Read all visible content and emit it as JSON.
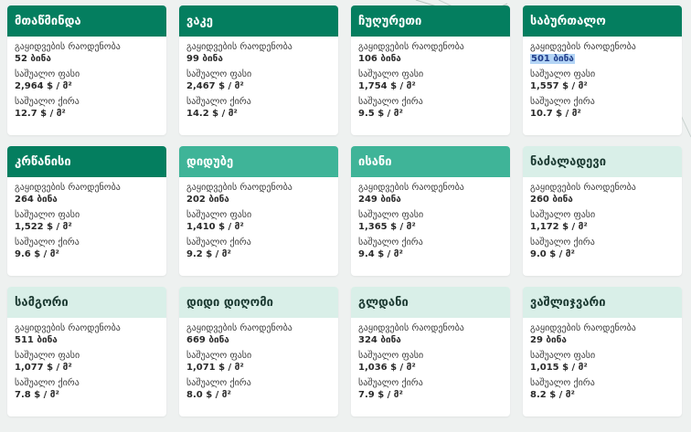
{
  "cards": [
    {
      "name": "მთაწმინდა",
      "listings_label": "გაყიდვების რაოდენობა",
      "listings": "52 ბინა",
      "price_label": "საშუალო ფასი",
      "price": "2,964 $ / მ²",
      "rent_label": "საშუალო ქირა",
      "rent": "12.7 $ / მ²",
      "header_style": "dark",
      "highlight_listings": false
    },
    {
      "name": "ვაკე",
      "listings_label": "გაყიდვების რაოდენობა",
      "listings": "99 ბინა",
      "price_label": "საშუალო ფასი",
      "price": "2,467 $ / მ²",
      "rent_label": "საშუალო ქირა",
      "rent": "14.2 $ / მ²",
      "header_style": "dark",
      "highlight_listings": false
    },
    {
      "name": "ჩუღურეთი",
      "listings_label": "გაყიდვების რაოდენობა",
      "listings": "106 ბინა",
      "price_label": "საშუალო ფასი",
      "price": "1,754 $ / მ²",
      "rent_label": "საშუალო ქირა",
      "rent": "9.5 $ / მ²",
      "header_style": "dark",
      "highlight_listings": false
    },
    {
      "name": "საბურთალო",
      "listings_label": "გაყიდვების რაოდენობა",
      "listings": "501 ბინა",
      "price_label": "საშუალო ფასი",
      "price": "1,557 $ / მ²",
      "rent_label": "საშუალო ქირა",
      "rent": "10.7 $ / მ²",
      "header_style": "dark",
      "highlight_listings": true
    },
    {
      "name": "კრწანისი",
      "listings_label": "გაყიდვების რაოდენობა",
      "listings": "264 ბინა",
      "price_label": "საშუალო ფასი",
      "price": "1,522 $ / მ²",
      "rent_label": "საშუალო ქირა",
      "rent": "9.6 $ / მ²",
      "header_style": "dark",
      "highlight_listings": false
    },
    {
      "name": "დიდუბე",
      "listings_label": "გაყიდვების რაოდენობა",
      "listings": "202 ბინა",
      "price_label": "საშუალო ფასი",
      "price": "1,410 $ / მ²",
      "rent_label": "საშუალო ქირა",
      "rent": "9.2 $ / მ²",
      "header_style": "mid",
      "highlight_listings": false
    },
    {
      "name": "ისანი",
      "listings_label": "გაყიდვების რაოდენობა",
      "listings": "249 ბინა",
      "price_label": "საშუალო ფასი",
      "price": "1,365 $ / მ²",
      "rent_label": "საშუალო ქირა",
      "rent": "9.4 $ / მ²",
      "header_style": "mid",
      "highlight_listings": false
    },
    {
      "name": "ნაძალადევი",
      "listings_label": "გაყიდვების რაოდენობა",
      "listings": "260 ბინა",
      "price_label": "საშუალო ფასი",
      "price": "1,172 $ / მ²",
      "rent_label": "საშუალო ქირა",
      "rent": "9.0 $ / მ²",
      "header_style": "light",
      "highlight_listings": false
    },
    {
      "name": "სამგორი",
      "listings_label": "გაყიდვების რაოდენობა",
      "listings": "511 ბინა",
      "price_label": "საშუალო ფასი",
      "price": "1,077 $ / მ²",
      "rent_label": "საშუალო ქირა",
      "rent": "7.8 $ / მ²",
      "header_style": "light",
      "highlight_listings": false
    },
    {
      "name": "დიდი დიღომი",
      "listings_label": "გაყიდვების რაოდენობა",
      "listings": "669 ბინა",
      "price_label": "საშუალო ფასი",
      "price": "1,071 $ / მ²",
      "rent_label": "საშუალო ქირა",
      "rent": "8.0 $ / მ²",
      "header_style": "light",
      "highlight_listings": false
    },
    {
      "name": "გლდანი",
      "listings_label": "გაყიდვების რაოდენობა",
      "listings": "324 ბინა",
      "price_label": "საშუალო ფასი",
      "price": "1,036 $ / მ²",
      "rent_label": "საშუალო ქირა",
      "rent": "7.9 $ / მ²",
      "header_style": "light",
      "highlight_listings": false
    },
    {
      "name": "ვაშლიჯვარი",
      "listings_label": "გაყიდვების რაოდენობა",
      "listings": "29 ბინა",
      "price_label": "საშუალო ფასი",
      "price": "1,015 $ / მ²",
      "rent_label": "საშუალო ქირა",
      "rent": "8.2 $ / მ²",
      "header_style": "light",
      "highlight_listings": false
    }
  ],
  "colors": {
    "header_dark": "#047e5f",
    "header_mid": "#3fb498",
    "header_light": "#d9efe8",
    "page_bg": "#eef1f0",
    "selection_highlight": "#b3d4f5"
  }
}
